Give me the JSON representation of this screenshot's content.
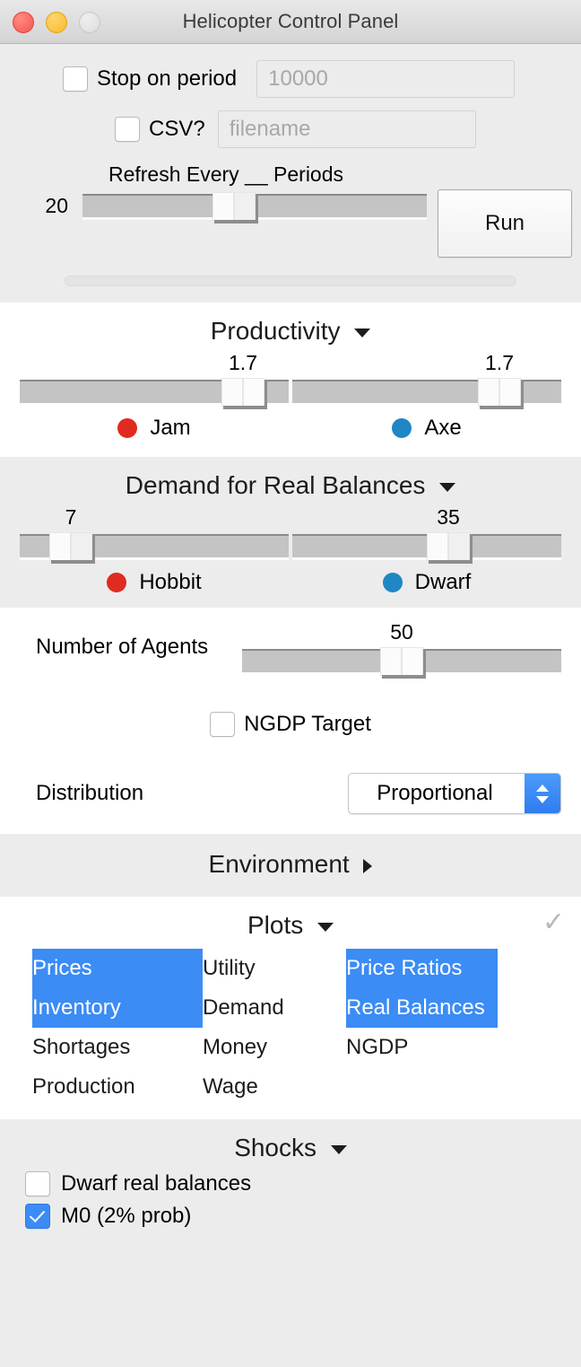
{
  "window": {
    "title": "Helicopter Control Panel",
    "traffic_lights": [
      "close-red",
      "minimize-yellow",
      "zoom-gray-disabled"
    ]
  },
  "top": {
    "stop_on_period": {
      "label": "Stop on period",
      "checked": false,
      "placeholder": "10000",
      "value": ""
    },
    "csv": {
      "label": "CSV?",
      "checked": false,
      "placeholder": "filename",
      "value": ""
    },
    "refresh": {
      "title": "Refresh Every __ Periods",
      "value": "20",
      "percent": 44
    },
    "run_button": "Run"
  },
  "productivity": {
    "header": "Productivity",
    "expanded": true,
    "sliders": [
      {
        "value": "1.7",
        "percent": 83,
        "legend": "Jam",
        "color": "#e02b20"
      },
      {
        "value": "1.7",
        "percent": 77,
        "legend": "Axe",
        "color": "#1f87c4"
      }
    ]
  },
  "demand": {
    "header": "Demand for Real Balances",
    "expanded": true,
    "sliders": [
      {
        "value": "7",
        "percent": 19,
        "legend": "Hobbit",
        "color": "#e02b20"
      },
      {
        "value": "35",
        "percent": 58,
        "legend": "Dwarf",
        "color": "#1f87c4"
      }
    ]
  },
  "agents": {
    "label": "Number of Agents",
    "value": "50",
    "percent": 50
  },
  "ngdp": {
    "label": "NGDP Target",
    "checked": false
  },
  "distribution": {
    "label": "Distribution",
    "selected": "Proportional"
  },
  "environment": {
    "header": "Environment",
    "expanded": false
  },
  "plots": {
    "header": "Plots",
    "expanded": true,
    "check_icon": "checkmark-icon",
    "columns": [
      [
        {
          "label": "Prices",
          "selected": true
        },
        {
          "label": "Inventory",
          "selected": true
        },
        {
          "label": "Shortages",
          "selected": false
        },
        {
          "label": "Production",
          "selected": false
        }
      ],
      [
        {
          "label": "Utility",
          "selected": false
        },
        {
          "label": "Demand",
          "selected": false
        },
        {
          "label": "Money",
          "selected": false
        },
        {
          "label": "Wage",
          "selected": false
        }
      ],
      [
        {
          "label": "Price Ratios",
          "selected": true
        },
        {
          "label": "Real Balances",
          "selected": true
        },
        {
          "label": "NGDP",
          "selected": false
        }
      ]
    ]
  },
  "shocks": {
    "header": "Shocks",
    "expanded": true,
    "items": [
      {
        "label": "Dwarf real balances",
        "checked": false
      },
      {
        "label": "M0 (2% prob)",
        "checked": true
      }
    ]
  },
  "colors": {
    "selection_blue": "#3b8cf5",
    "red_dot": "#e02b20",
    "blue_dot": "#1f87c4",
    "panel_gray": "#ececec"
  }
}
